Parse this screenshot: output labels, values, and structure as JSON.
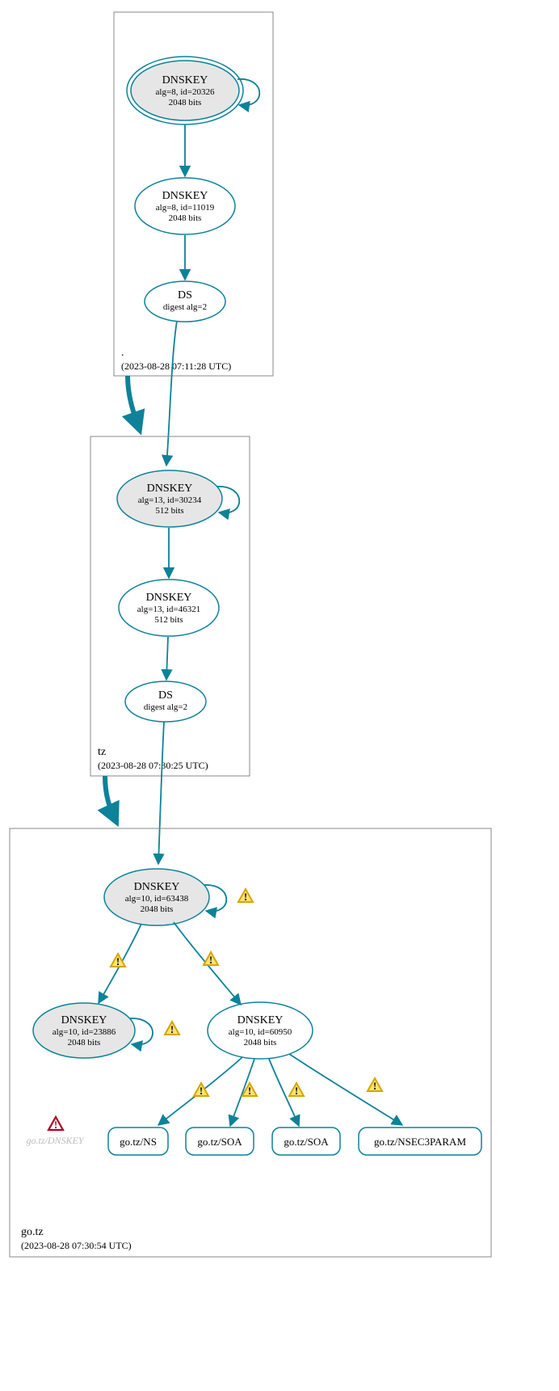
{
  "zones": {
    "root": {
      "name": ".",
      "ts": "(2023-08-28 07:11:28 UTC)"
    },
    "tz": {
      "name": "tz",
      "ts": "(2023-08-28 07:30:25 UTC)"
    },
    "gotz": {
      "name": "go.tz",
      "ts": "(2023-08-28 07:30:54 UTC)"
    }
  },
  "nodes": {
    "root_ksk": {
      "title": "DNSKEY",
      "l2": "alg=8, id=20326",
      "l3": "2048 bits"
    },
    "root_zsk": {
      "title": "DNSKEY",
      "l2": "alg=8, id=11019",
      "l3": "2048 bits"
    },
    "root_ds": {
      "title": "DS",
      "l2": "digest alg=2"
    },
    "tz_ksk": {
      "title": "DNSKEY",
      "l2": "alg=13, id=30234",
      "l3": "512 bits"
    },
    "tz_zsk": {
      "title": "DNSKEY",
      "l2": "alg=13, id=46321",
      "l3": "512 bits"
    },
    "tz_ds": {
      "title": "DS",
      "l2": "digest alg=2"
    },
    "gotz_ksk": {
      "title": "DNSKEY",
      "l2": "alg=10, id=63438",
      "l3": "2048 bits"
    },
    "gotz_k2": {
      "title": "DNSKEY",
      "l2": "alg=10, id=23886",
      "l3": "2048 bits"
    },
    "gotz_zsk": {
      "title": "DNSKEY",
      "l2": "alg=10, id=60950",
      "l3": "2048 bits"
    }
  },
  "rrsets": {
    "ns": "go.tz/NS",
    "soa1": "go.tz/SOA",
    "soa2": "go.tz/SOA",
    "nsec3": "go.tz/NSEC3PARAM"
  },
  "ghost": "go.tz/DNSKEY"
}
